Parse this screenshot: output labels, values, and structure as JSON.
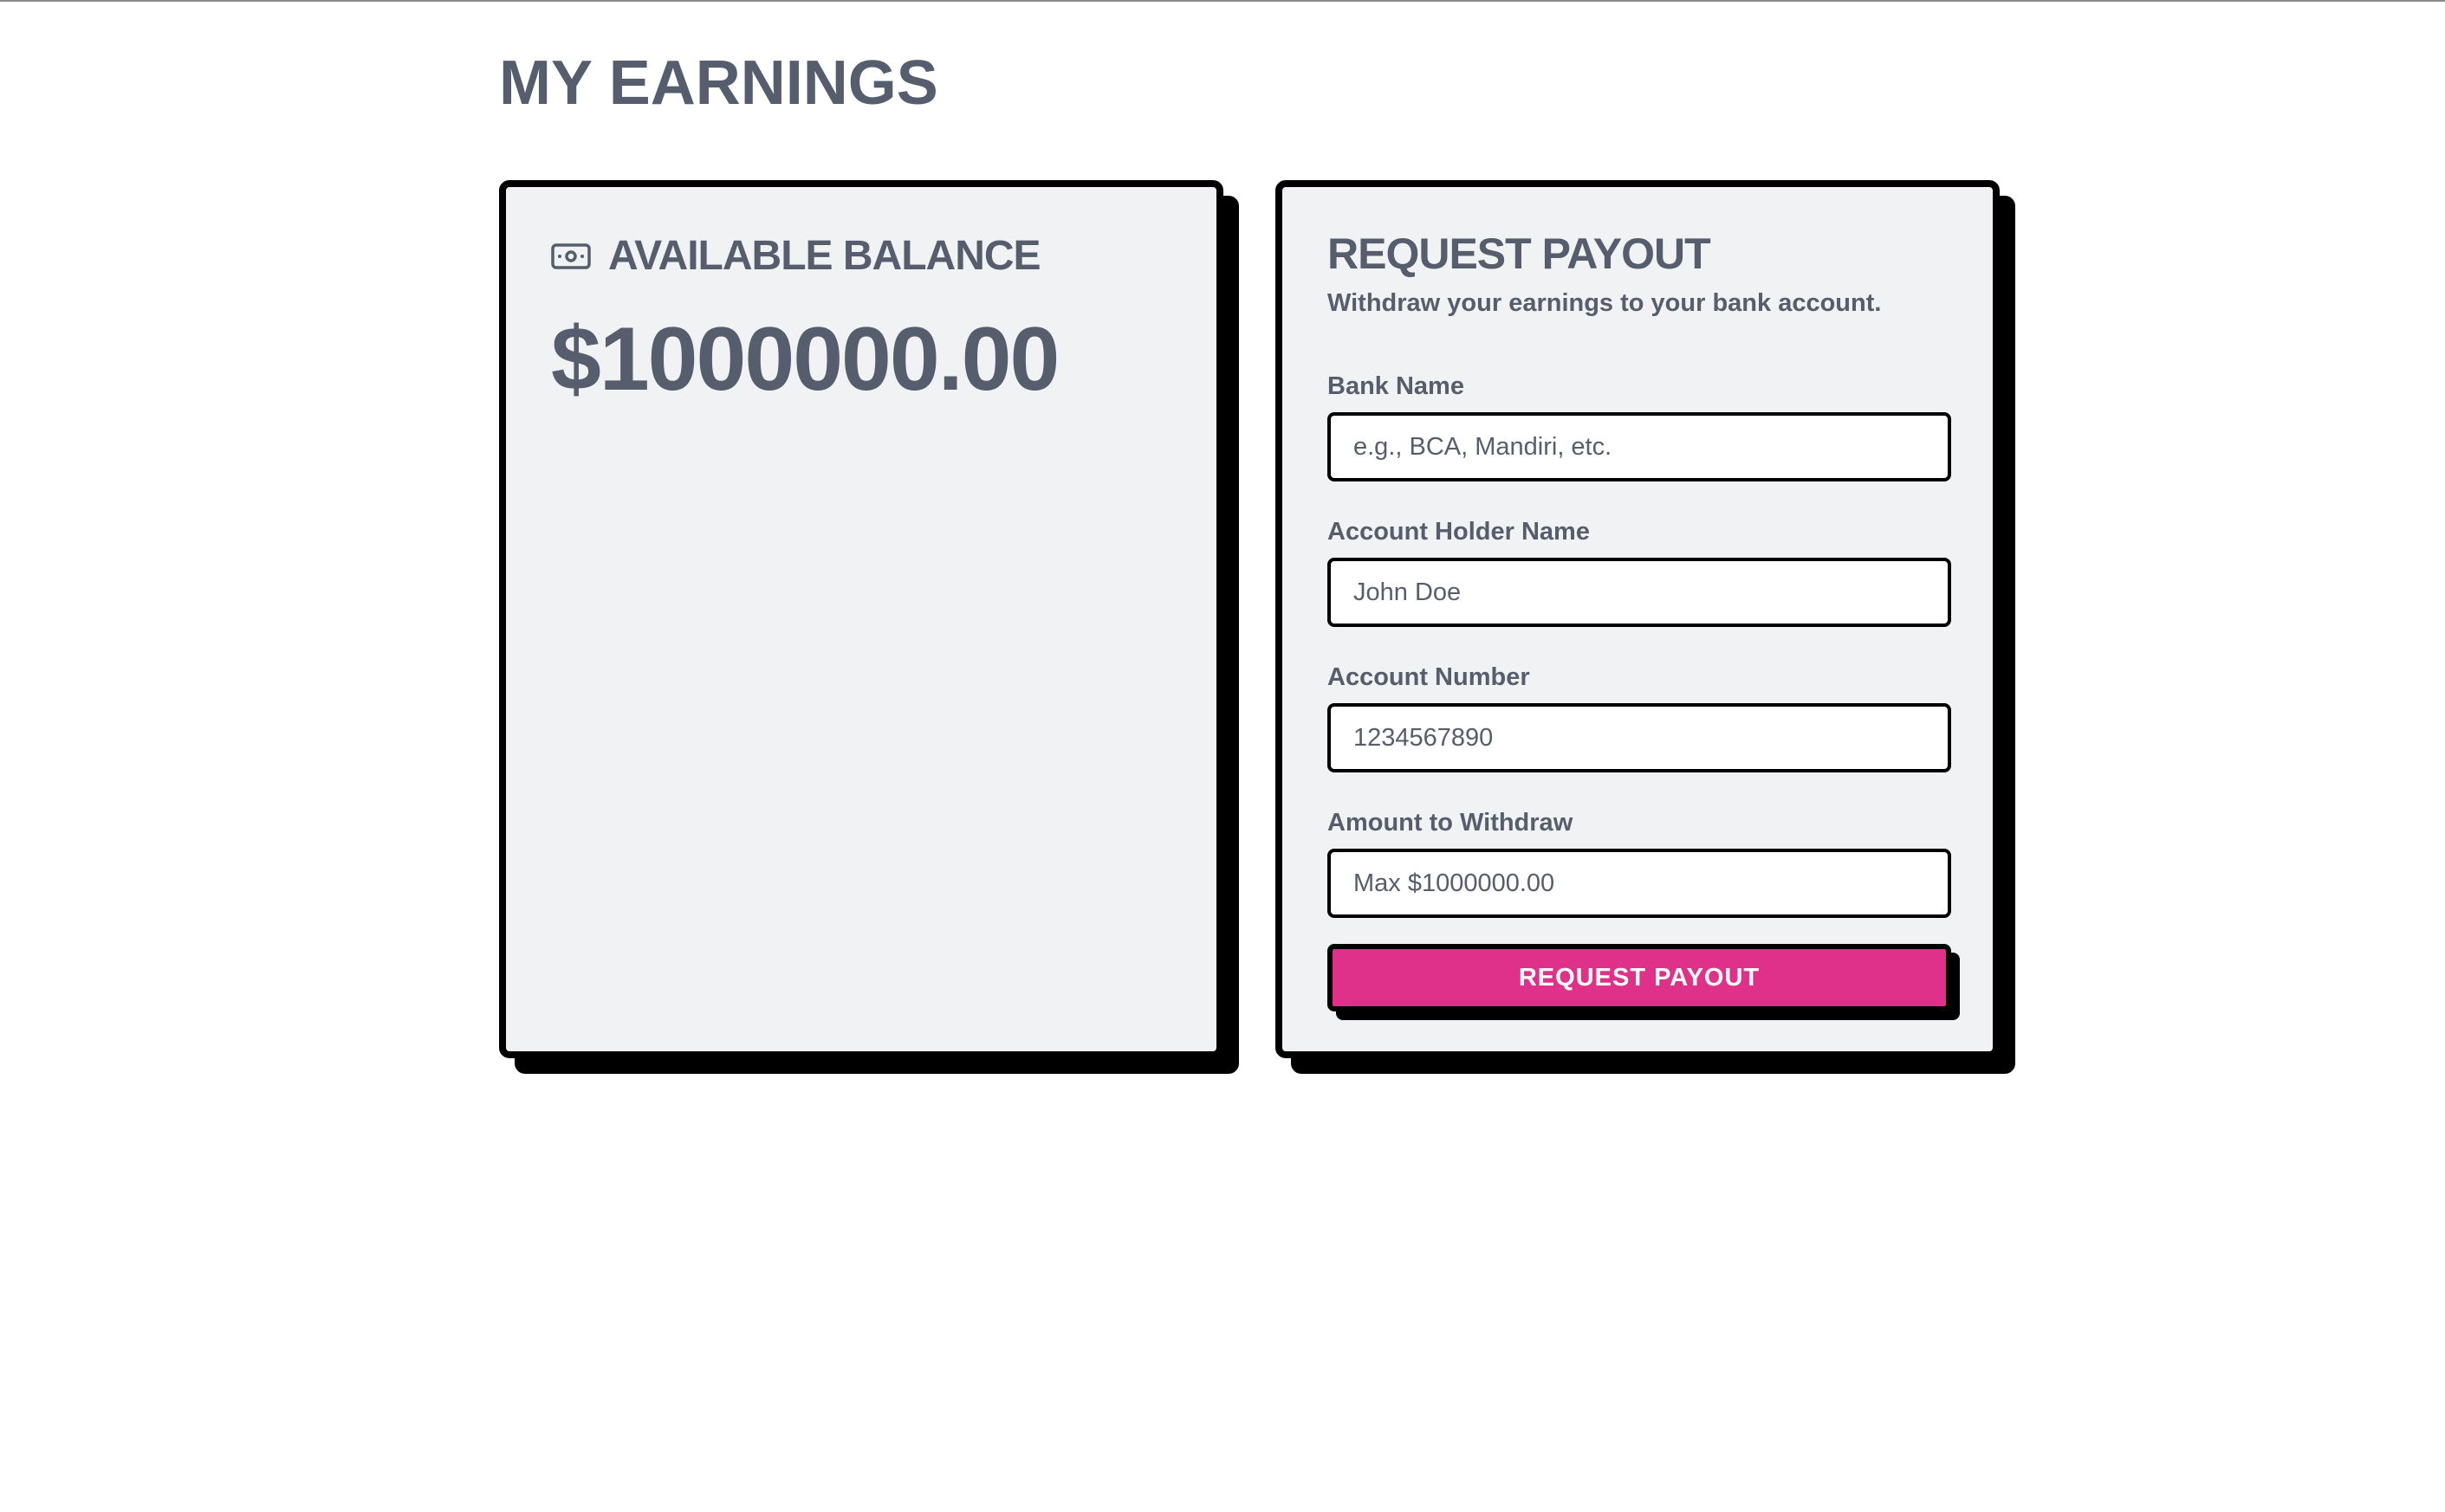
{
  "page": {
    "title": "MY EARNINGS"
  },
  "balance": {
    "label": "AVAILABLE BALANCE",
    "amount": "$1000000.00",
    "icon": "money-icon"
  },
  "payout": {
    "title": "REQUEST PAYOUT",
    "subtitle": "Withdraw your earnings to your bank account.",
    "fields": {
      "bank_name": {
        "label": "Bank Name",
        "value": "",
        "placeholder": "e.g., BCA, Mandiri, etc."
      },
      "account_holder": {
        "label": "Account Holder Name",
        "value": "",
        "placeholder": "John Doe"
      },
      "account_number": {
        "label": "Account Number",
        "value": "",
        "placeholder": "1234567890"
      },
      "amount": {
        "label": "Amount to Withdraw",
        "value": "",
        "placeholder": "Max $1000000.00"
      }
    },
    "submit_label": "REQUEST PAYOUT"
  },
  "colors": {
    "text": "#565d6d",
    "card_background": "#f1f2f4",
    "border": "#000000",
    "accent": "#e0318a"
  }
}
